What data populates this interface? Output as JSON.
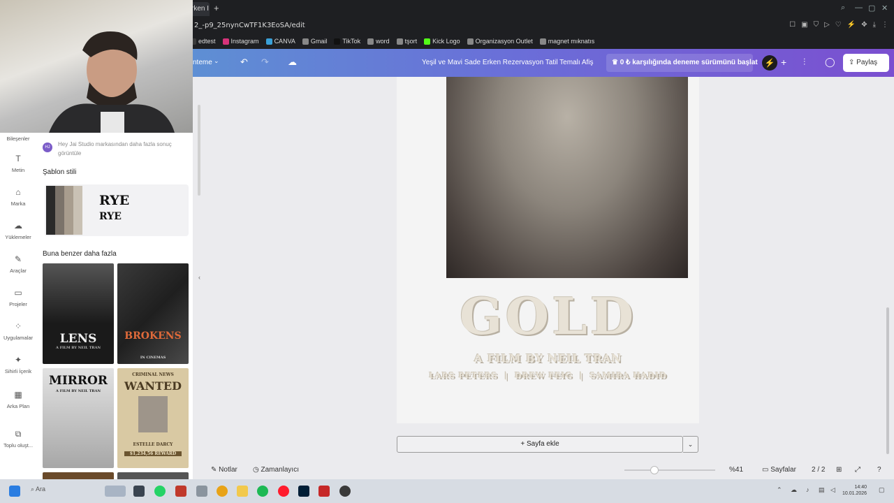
{
  "browser": {
    "tab_label": "rken I",
    "new_tab": "+",
    "url": "2_-p9_25nynCwTF1K3EoSA/edit",
    "bookmarks": [
      {
        "label": "edtest",
        "color": "#3a3a3a"
      },
      {
        "label": "Instagram",
        "color": "#d6337a"
      },
      {
        "label": "CANVA",
        "color": "#3aa0d8"
      },
      {
        "label": "Gmail",
        "color": "#888888"
      },
      {
        "label": "TikTok",
        "color": "#111111"
      },
      {
        "label": "word",
        "color": "#888888"
      },
      {
        "label": "tşort",
        "color": "#888888"
      },
      {
        "label": "Kick Logo",
        "color": "#53fc18"
      },
      {
        "label": "Organizasyon Outlet",
        "color": "#888888"
      },
      {
        "label": "magnet mıknatıs",
        "color": "#888888"
      }
    ]
  },
  "toolbar": {
    "theme_label": "nteme",
    "design_title": "Yeşil ve Mavi Sade Erken Rezervasyon Tatil Temalı Afiş",
    "trial_label": "♛ 0 ₺ karşılığında deneme sürümünü başlat",
    "share_label": "Paylaş",
    "accent": "#6a6fd8"
  },
  "rail": [
    {
      "label": "Bileşenler",
      "icon": "shapes-icon",
      "glyph": "◇"
    },
    {
      "label": "Metin",
      "icon": "text-icon",
      "glyph": "T"
    },
    {
      "label": "Marka",
      "icon": "brand-icon",
      "glyph": "⌂"
    },
    {
      "label": "Yüklemeler",
      "icon": "upload-icon",
      "glyph": "☁"
    },
    {
      "label": "Araçlar",
      "icon": "tools-icon",
      "glyph": "✎"
    },
    {
      "label": "Projeler",
      "icon": "folder-icon",
      "glyph": "▭"
    },
    {
      "label": "Uygulamalar",
      "icon": "apps-icon",
      "glyph": "⁘"
    },
    {
      "label": "Sihirli İçerik",
      "icon": "magic-icon",
      "glyph": "✦"
    },
    {
      "label": "Arka Plan",
      "icon": "background-icon",
      "glyph": "▦"
    },
    {
      "label": "Toplu oluşt...",
      "icon": "bulk-create-icon",
      "glyph": "⧉"
    }
  ],
  "panel": {
    "avatar": "HJ",
    "notice": "Hey Jai Studio markasından daha fazla sonuç görüntüle",
    "template_style_heading": "Şablon stili",
    "font_name_large": "RYE",
    "font_name_small": "RYE",
    "swatches": [
      "#2a2a2a",
      "#7b736a",
      "#a89d8e",
      "#c9c1b4"
    ],
    "more_like_heading": "Buna benzer daha fazla",
    "thumbs": [
      {
        "title": "LENS",
        "subtitle": "A FILM BY NEIL TRAN",
        "bg": "#1a1a1a",
        "fg": "#e8e8e8"
      },
      {
        "title": "BROKENS",
        "subtitle": "IN CINEMAS",
        "bg": "#2b2b2b",
        "fg": "#e06a3a"
      },
      {
        "title": "MIRROR",
        "subtitle": "A FILM BY NEIL TRAN",
        "bg": "#d8d8d8",
        "fg": "#111111"
      },
      {
        "title": "WANTED",
        "subtitle": "ESTELLE DARCY",
        "bg": "#d9c9a3",
        "fg": "#4a3a22"
      }
    ],
    "wanted_header": "CRIMINAL NEWS",
    "wanted_reward": "$1,234,56 REWARD"
  },
  "canvas": {
    "poster_title": "GOLD",
    "poster_byline": "A FILM BY NEIL TRAN",
    "poster_cast": "LARS PETERS  |  DREW FEIG  |  SAMIRA HADID",
    "add_page": "+ Sayfa ekle"
  },
  "status": {
    "notes": "Notlar",
    "timer": "Zamanlayıcı",
    "zoom": "%41",
    "zoom_fraction": 0.41,
    "pages_label": "Sayfalar",
    "page_count": "2 / 2"
  },
  "taskbar": {
    "search_placeholder": "Ara",
    "time": "14:40",
    "date": "10.01.2026"
  }
}
